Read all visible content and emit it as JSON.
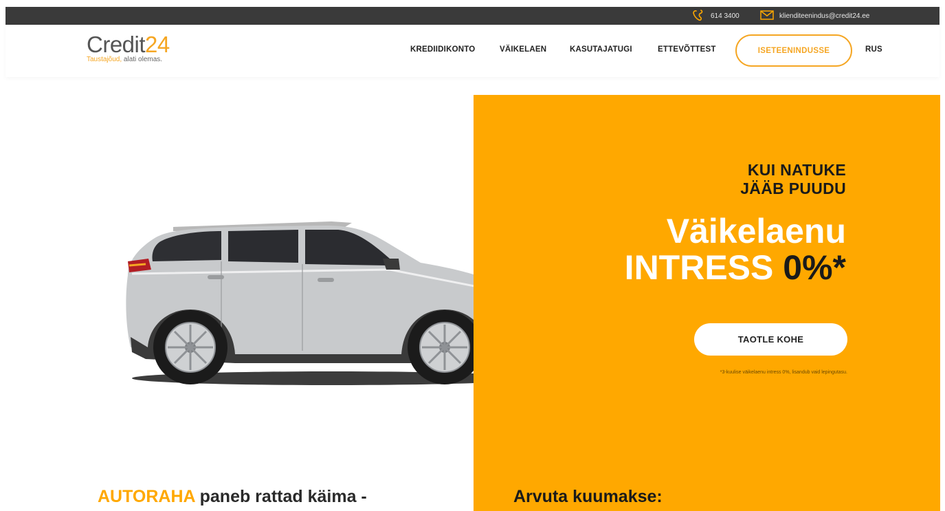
{
  "topbar": {
    "phone": "614 3400",
    "email": "klienditeenindus@credit24.ee",
    "phone_icon": "phone-icon",
    "email_icon": "mail-icon"
  },
  "brand": {
    "logo_text": "Credit",
    "logo_number": "24",
    "tagline_highlight": "Taustajõud,",
    "tagline_rest": " alati olemas."
  },
  "nav": {
    "items": [
      "KREDIIDIKONTO",
      "VÄIKELAEN",
      "KASUTAJATUGI",
      "ETTEVÕTTEST"
    ],
    "cta": "ISETEENINDUSSE",
    "language": "RUS"
  },
  "hero": {
    "kicker_line1": "KUI NATUKE",
    "kicker_line2": "JÄÄB PUUDU",
    "headline_line1": "Väikelaenu",
    "headline_line2_a": "INTRESS ",
    "headline_line2_b": "0%*",
    "button": "TAOTLE KOHE",
    "footnote": "*3-kuulise väikelaenu intress 0%, lisandub vaid lepingutasu."
  },
  "sections": {
    "autoraha_highlight": "AUTORAHA",
    "autoraha_rest": " paneb rattad käima -",
    "calculator_title": "Arvuta kuumakse:"
  },
  "colors": {
    "accent": "#ffa800",
    "topbar": "#3a3a3a",
    "text": "#1a1a1a"
  }
}
